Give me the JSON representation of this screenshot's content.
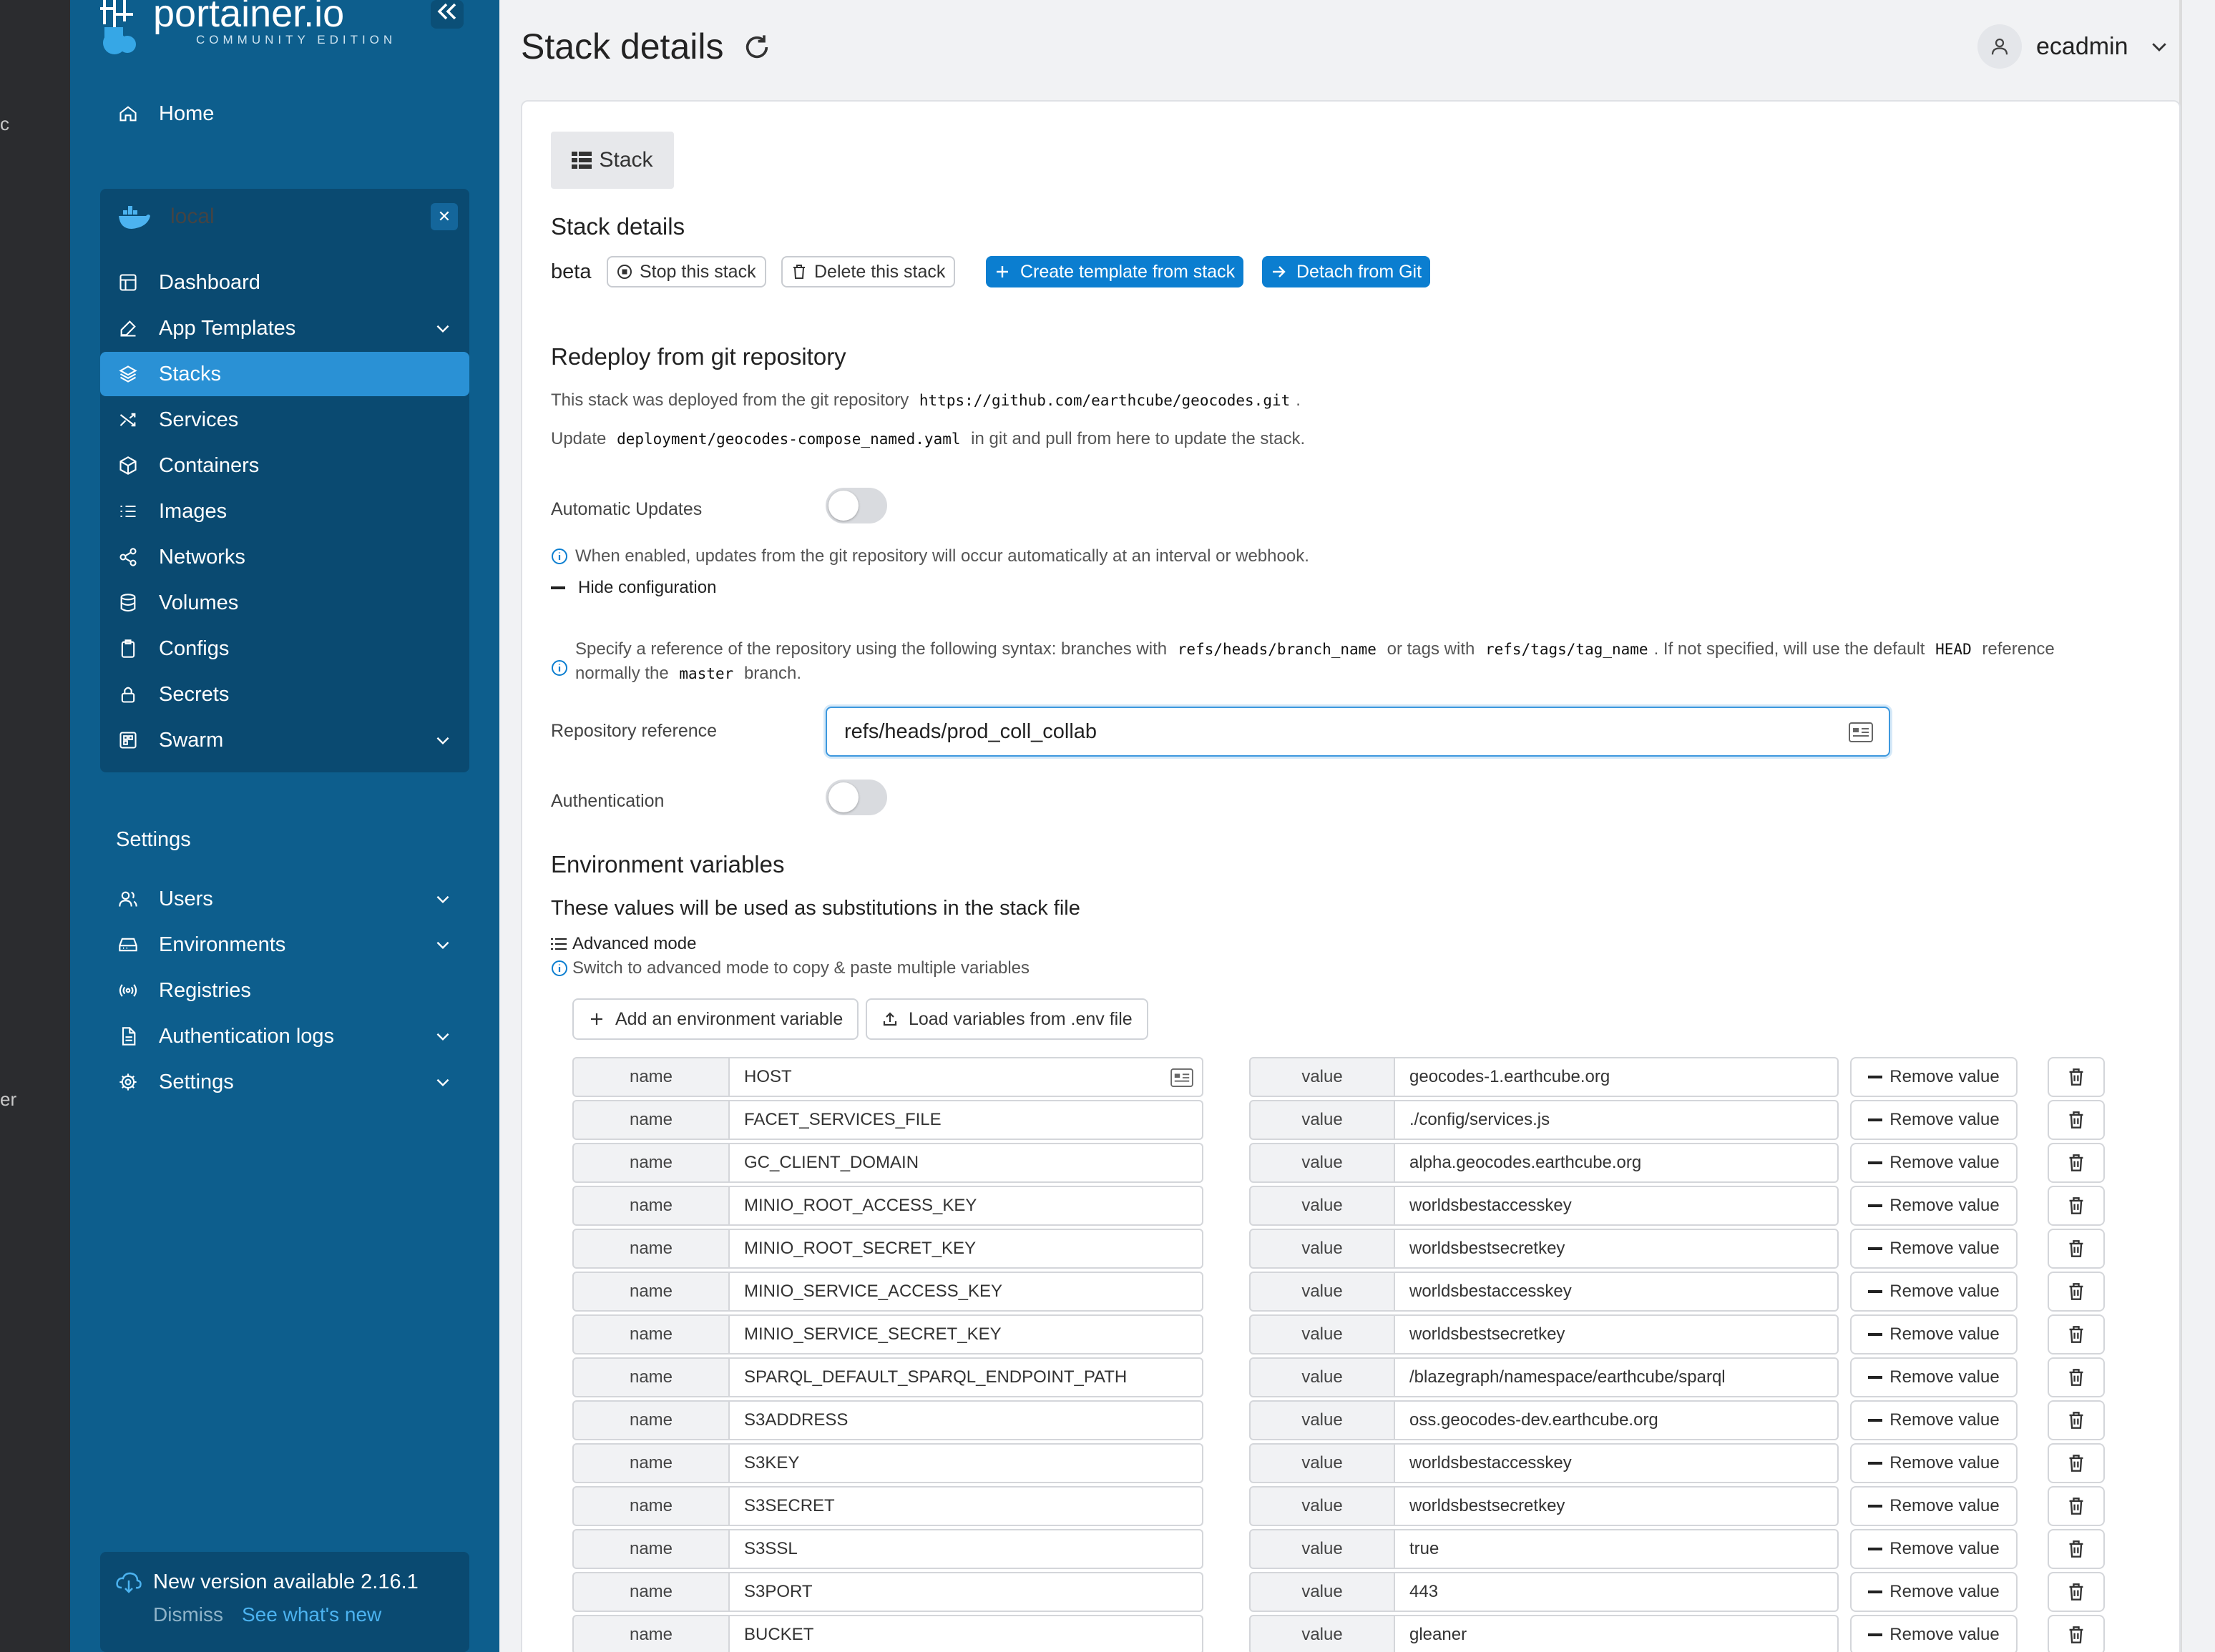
{
  "sidebar": {
    "logo_text": "portainer.io",
    "edition": "COMMUNITY EDITION",
    "home": "Home",
    "environment": {
      "name": "local",
      "items": [
        {
          "label": "Dashboard",
          "icon": "dashboard-icon"
        },
        {
          "label": "App Templates",
          "icon": "edit-icon",
          "chevron": true
        },
        {
          "label": "Stacks",
          "icon": "layers-icon",
          "active": true
        },
        {
          "label": "Services",
          "icon": "shuffle-icon"
        },
        {
          "label": "Containers",
          "icon": "box-icon"
        },
        {
          "label": "Images",
          "icon": "list-icon"
        },
        {
          "label": "Networks",
          "icon": "share-icon"
        },
        {
          "label": "Volumes",
          "icon": "database-icon"
        },
        {
          "label": "Configs",
          "icon": "clipboard-icon"
        },
        {
          "label": "Secrets",
          "icon": "lock-icon"
        },
        {
          "label": "Swarm",
          "icon": "swarm-icon",
          "chevron": true
        }
      ]
    },
    "settings_heading": "Settings",
    "settings_items": [
      {
        "label": "Users",
        "icon": "users-icon",
        "chevron": true
      },
      {
        "label": "Environments",
        "icon": "hdd-icon",
        "chevron": true
      },
      {
        "label": "Registries",
        "icon": "radio-icon"
      },
      {
        "label": "Authentication logs",
        "icon": "file-icon",
        "chevron": true
      },
      {
        "label": "Settings",
        "icon": "gear-icon",
        "chevron": true
      }
    ],
    "update": {
      "text": "New version available 2.16.1",
      "dismiss": "Dismiss",
      "whats_new": "See what's new"
    }
  },
  "header": {
    "title": "Stack details",
    "user": "ecadmin"
  },
  "left_strip": {
    "frag1": "c",
    "frag2": "er"
  },
  "stack": {
    "tab": "Stack",
    "details_heading": "Stack details",
    "name": "beta",
    "actions": {
      "stop": "Stop this stack",
      "delete": "Delete this stack",
      "template": "Create template from stack",
      "detach": "Detach from Git"
    }
  },
  "git": {
    "heading": "Redeploy from git repository",
    "deployed_prefix": "This stack was deployed from the git repository",
    "repo_url": "https://github.com/earthcube/geocodes.git",
    "deployed_suffix": ".",
    "update_prefix": "Update",
    "compose_path": "deployment/geocodes-compose_named.yaml",
    "update_suffix": "in git and pull from here to update the stack.",
    "auto_updates_label": "Automatic Updates",
    "auto_updates_help": "When enabled, updates from the git repository will occur automatically at an interval or webhook.",
    "hide_config": "Hide configuration",
    "ref_help_1": "Specify a reference of the repository using the following syntax: branches with",
    "ref_code_1": "refs/heads/branch_name",
    "ref_help_2": "or tags with",
    "ref_code_2": "refs/tags/tag_name",
    "ref_help_3": ". If not specified, will use the default",
    "ref_code_3": "HEAD",
    "ref_help_4": "reference",
    "ref_help_5": "normally the",
    "ref_code_4": "master",
    "ref_help_6": "branch.",
    "repo_ref_label": "Repository reference",
    "repo_ref_value": "refs/heads/prod_coll_collab",
    "auth_label": "Authentication"
  },
  "env": {
    "heading": "Environment variables",
    "subheading": "These values will be used as substitutions in the stack file",
    "advanced_mode": "Advanced mode",
    "advanced_help": "Switch to advanced mode to copy & paste multiple variables",
    "add_button": "Add an environment variable",
    "load_button": "Load variables from .env file",
    "name_label": "name",
    "value_label": "value",
    "remove_label": "Remove value",
    "rows": [
      {
        "name": "HOST",
        "value": "geocodes-1.earthcube.org"
      },
      {
        "name": "FACET_SERVICES_FILE",
        "value": "./config/services.js"
      },
      {
        "name": "GC_CLIENT_DOMAIN",
        "value": "alpha.geocodes.earthcube.org"
      },
      {
        "name": "MINIO_ROOT_ACCESS_KEY",
        "value": "worldsbestaccesskey"
      },
      {
        "name": "MINIO_ROOT_SECRET_KEY",
        "value": "worldsbestsecretkey"
      },
      {
        "name": "MINIO_SERVICE_ACCESS_KEY",
        "value": "worldsbestaccesskey"
      },
      {
        "name": "MINIO_SERVICE_SECRET_KEY",
        "value": "worldsbestsecretkey"
      },
      {
        "name": "SPARQL_DEFAULT_SPARQL_ENDPOINT_PATH",
        "value": "/blazegraph/namespace/earthcube/sparql"
      },
      {
        "name": "S3ADDRESS",
        "value": "oss.geocodes-dev.earthcube.org"
      },
      {
        "name": "S3KEY",
        "value": "worldsbestaccesskey"
      },
      {
        "name": "S3SECRET",
        "value": "worldsbestsecretkey"
      },
      {
        "name": "S3SSL",
        "value": "true"
      },
      {
        "name": "S3PORT",
        "value": "443"
      },
      {
        "name": "BUCKET",
        "value": "gleaner"
      }
    ]
  },
  "colors": {
    "sidebar": "#0d5e8d",
    "sidebar_active": "#2a91d5",
    "primary_button": "#0b7ed0"
  }
}
